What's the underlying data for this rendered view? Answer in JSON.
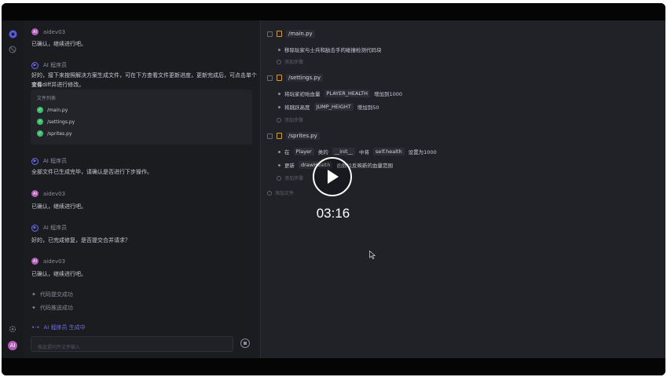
{
  "chat": {
    "user_name": "aidev03",
    "user_initial": "AI",
    "ai_name": "AI 程序员",
    "messages": [
      "已确认，继续进行吧。",
      "好的，接下来按照解决方案生成文件，可在下方查看文件更新进度，更新完成后，可点击单个文件",
      "查看diff并进行修改。",
      "全部文件已生成完毕，请确认是否进行下步操作。",
      "已确认，继续进行吧。",
      "好的，已完成修复，是否提交合并请求？",
      "已确认，继续进行吧。"
    ],
    "file_list_title": "文件列表",
    "files": [
      "/main.py",
      "/settings.py",
      "/sprites.py"
    ],
    "system_events": [
      "代码提交成功",
      "代码推送成功"
    ],
    "generating": "AI 程序员 生成中",
    "input_placeholder": "按此提问开文件输入"
  },
  "plan": {
    "files": [
      {
        "path": "/main.py",
        "steps": [
          [
            "移除玩家与士兵和敌击手的碰撞检测代码块"
          ]
        ]
      },
      {
        "path": "/settings.py",
        "steps": [
          [
            "将玩家初始血量",
            "PLAYER_HEALTH",
            "增加到1000"
          ],
          [
            "将跳跃高度",
            "JUMP_HEIGHT",
            "增加到50"
          ]
        ]
      },
      {
        "path": "/sprites.py",
        "steps": [
          [
            "在",
            "Player",
            "类的",
            "__init__",
            "中将",
            "self.health",
            "设置为1000"
          ],
          [
            "更新",
            "drawHealth",
            "函数以反映新的血量范围"
          ]
        ]
      }
    ],
    "add_step": "添加步骤",
    "add_file": "添加文件"
  },
  "video": {
    "time": "03:16"
  }
}
